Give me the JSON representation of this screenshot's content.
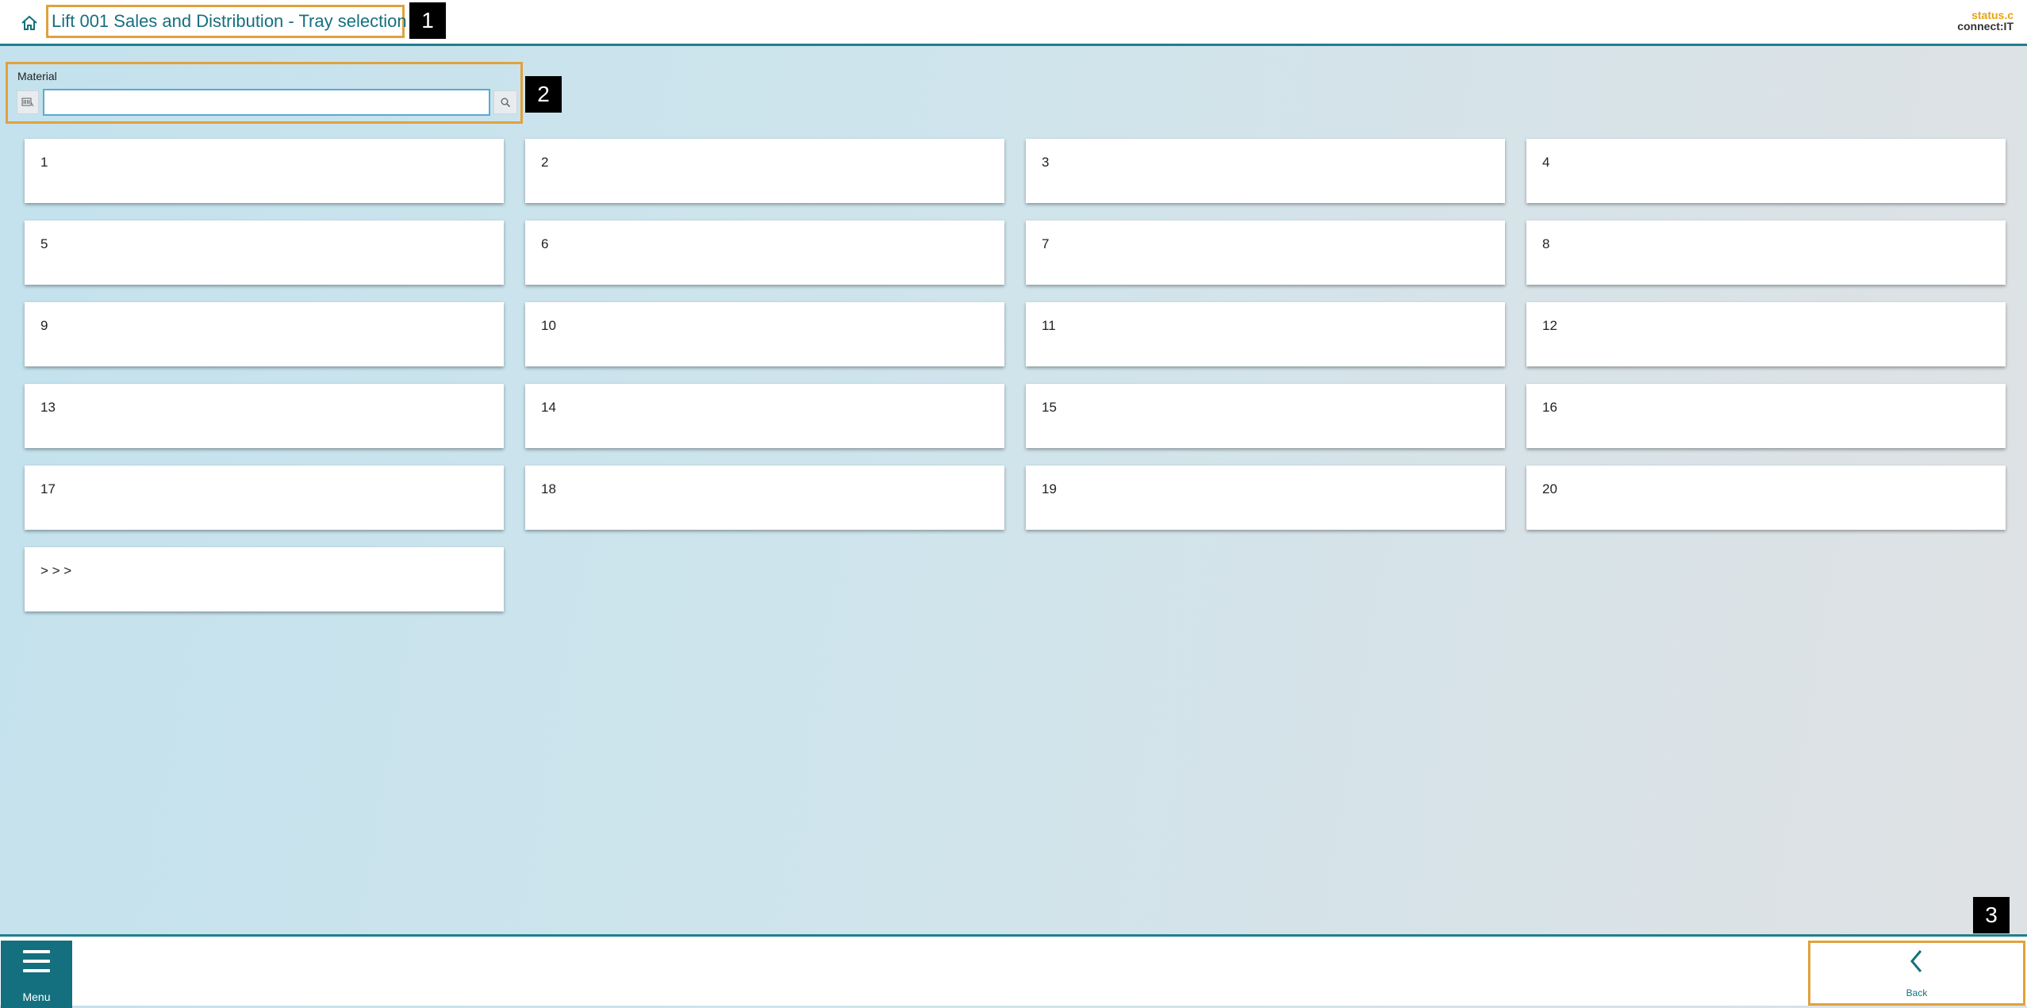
{
  "header": {
    "title": "Lift 001 Sales and Distribution - Tray selection",
    "home_icon": "home-icon",
    "brand_line1": "status.c",
    "brand_line2": "connect:IT"
  },
  "markers": [
    "1",
    "2",
    "3"
  ],
  "material": {
    "label": "Material",
    "value": "",
    "placeholder": "",
    "scan_icon": "barcode-scan-icon",
    "search_icon": "search-icon"
  },
  "trays": [
    {
      "label": "1"
    },
    {
      "label": "2"
    },
    {
      "label": "3"
    },
    {
      "label": "4"
    },
    {
      "label": "5"
    },
    {
      "label": "6"
    },
    {
      "label": "7"
    },
    {
      "label": "8"
    },
    {
      "label": "9"
    },
    {
      "label": "10"
    },
    {
      "label": "11"
    },
    {
      "label": "12"
    },
    {
      "label": "13"
    },
    {
      "label": "14"
    },
    {
      "label": "15"
    },
    {
      "label": "16"
    },
    {
      "label": "17"
    },
    {
      "label": "18"
    },
    {
      "label": "19"
    },
    {
      "label": "20"
    },
    {
      "label": "> > >"
    }
  ],
  "footer": {
    "menu_label": "Menu",
    "back_label": "Back"
  },
  "colors": {
    "accent": "#14707f",
    "highlight": "#e0a23c",
    "brand_orange": "#e8a317"
  }
}
